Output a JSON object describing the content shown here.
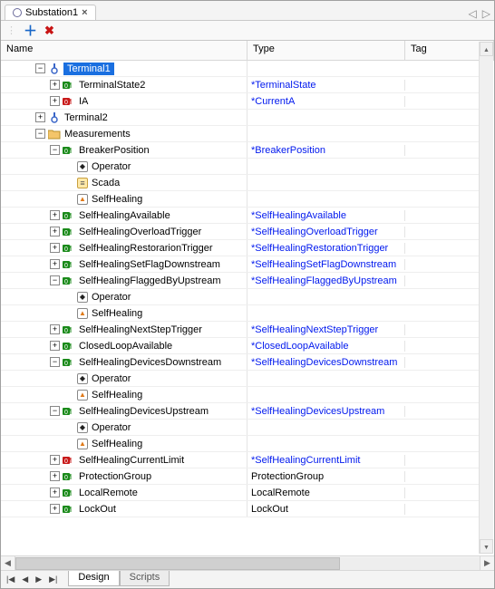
{
  "tab": {
    "title": "Substation1"
  },
  "columns": {
    "name": "Name",
    "type": "Type",
    "tag": "Tag"
  },
  "bottomTabs": {
    "design": "Design",
    "scripts": "Scripts"
  },
  "rows": [
    {
      "indent": 2,
      "toggle": "-",
      "icon": "terminal",
      "label": "Terminal1",
      "type": "",
      "selected": true
    },
    {
      "indent": 3,
      "toggle": "+",
      "icon": "tag-green",
      "label": "TerminalState2",
      "type": "*TerminalState"
    },
    {
      "indent": 3,
      "toggle": "+",
      "icon": "tag-red",
      "label": "IA",
      "type": "*CurrentA"
    },
    {
      "indent": 2,
      "toggle": "+",
      "icon": "terminal",
      "label": "Terminal2",
      "type": ""
    },
    {
      "indent": 2,
      "toggle": "-",
      "icon": "folder",
      "label": "Measurements",
      "type": ""
    },
    {
      "indent": 3,
      "toggle": "-",
      "icon": "tag-green",
      "label": "BreakerPosition",
      "type": "*BreakerPosition"
    },
    {
      "indent": 4,
      "toggle": "",
      "icon": "diamond",
      "label": "Operator",
      "type": ""
    },
    {
      "indent": 4,
      "toggle": "",
      "icon": "scada",
      "label": "Scada",
      "type": ""
    },
    {
      "indent": 4,
      "toggle": "",
      "icon": "flame",
      "label": "SelfHealing",
      "type": ""
    },
    {
      "indent": 3,
      "toggle": "+",
      "icon": "tag-green",
      "label": "SelfHealingAvailable",
      "type": "*SelfHealingAvailable"
    },
    {
      "indent": 3,
      "toggle": "+",
      "icon": "tag-green",
      "label": "SelfHealingOverloadTrigger",
      "type": "*SelfHealingOverloadTrigger"
    },
    {
      "indent": 3,
      "toggle": "+",
      "icon": "tag-green",
      "label": "SelfHealingRestorarionTrigger",
      "type": "*SelfHealingRestorationTrigger"
    },
    {
      "indent": 3,
      "toggle": "+",
      "icon": "tag-green",
      "label": "SelfHealingSetFlagDownstream",
      "type": "*SelfHealingSetFlagDownstream"
    },
    {
      "indent": 3,
      "toggle": "-",
      "icon": "tag-green",
      "label": "SelfHealingFlaggedByUpstream",
      "type": "*SelfHealingFlaggedByUpstream"
    },
    {
      "indent": 4,
      "toggle": "",
      "icon": "diamond",
      "label": "Operator",
      "type": ""
    },
    {
      "indent": 4,
      "toggle": "",
      "icon": "flame",
      "label": "SelfHealing",
      "type": ""
    },
    {
      "indent": 3,
      "toggle": "+",
      "icon": "tag-green",
      "label": "SelfHealingNextStepTrigger",
      "type": "*SelfHealingNextStepTrigger"
    },
    {
      "indent": 3,
      "toggle": "+",
      "icon": "tag-green",
      "label": "ClosedLoopAvailable",
      "type": "*ClosedLoopAvailable"
    },
    {
      "indent": 3,
      "toggle": "-",
      "icon": "tag-green",
      "label": "SelfHealingDevicesDownstream",
      "type": "*SelfHealingDevicesDownstream"
    },
    {
      "indent": 4,
      "toggle": "",
      "icon": "diamond",
      "label": "Operator",
      "type": ""
    },
    {
      "indent": 4,
      "toggle": "",
      "icon": "flame",
      "label": "SelfHealing",
      "type": ""
    },
    {
      "indent": 3,
      "toggle": "-",
      "icon": "tag-green",
      "label": "SelfHealingDevicesUpstream",
      "type": "*SelfHealingDevicesUpstream"
    },
    {
      "indent": 4,
      "toggle": "",
      "icon": "diamond",
      "label": "Operator",
      "type": ""
    },
    {
      "indent": 4,
      "toggle": "",
      "icon": "flame",
      "label": "SelfHealing",
      "type": ""
    },
    {
      "indent": 3,
      "toggle": "+",
      "icon": "tag-red",
      "label": "SelfHealingCurrentLimit",
      "type": "*SelfHealingCurrentLimit"
    },
    {
      "indent": 3,
      "toggle": "+",
      "icon": "tag-green",
      "label": "ProtectionGroup",
      "type": "ProtectionGroup",
      "typeBlack": true
    },
    {
      "indent": 3,
      "toggle": "+",
      "icon": "tag-green",
      "label": "LocalRemote",
      "type": "LocalRemote",
      "typeBlack": true
    },
    {
      "indent": 3,
      "toggle": "+",
      "icon": "tag-green",
      "label": "LockOut",
      "type": "LockOut",
      "typeBlack": true
    }
  ]
}
